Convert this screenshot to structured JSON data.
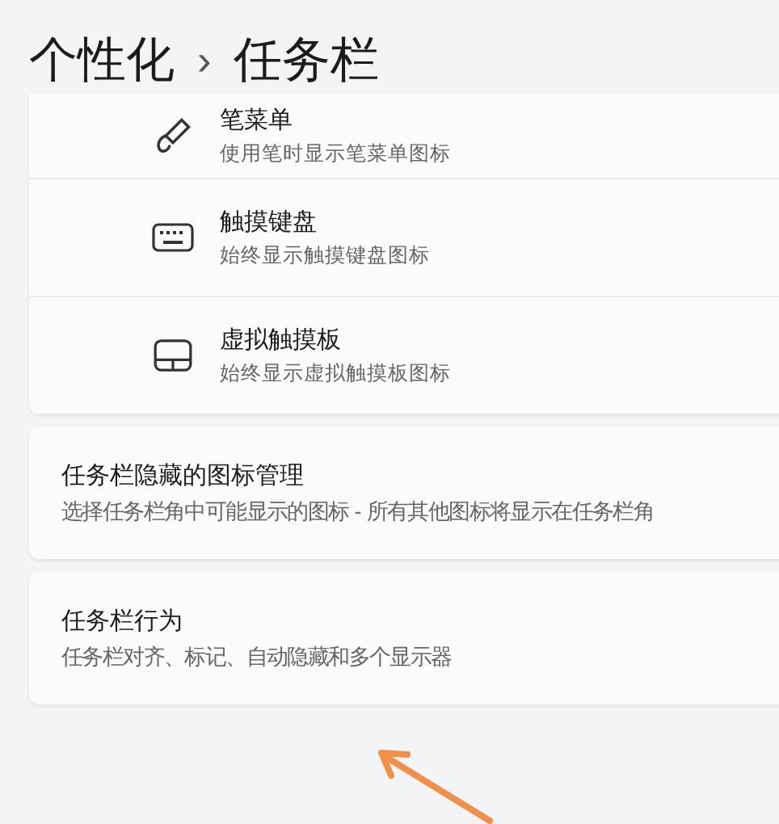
{
  "breadcrumb": {
    "parent": "个性化",
    "separator": "›",
    "current": "任务栏"
  },
  "corner_overflow_items": [
    {
      "kind": "pen",
      "title": "笔菜单",
      "subtitle": "使用笔时显示笔菜单图标"
    },
    {
      "kind": "keyboard",
      "title": "触摸键盘",
      "subtitle": "始终显示触摸键盘图标"
    },
    {
      "kind": "touchpad",
      "title": "虚拟触摸板",
      "subtitle": "始终显示虚拟触摸板图标"
    }
  ],
  "sections": [
    {
      "title": "任务栏隐藏的图标管理",
      "subtitle": "选择任务栏角中可能显示的图标 - 所有其他图标将显示在任务栏角"
    },
    {
      "title": "任务栏行为",
      "subtitle": "任务栏对齐、标记、自动隐藏和多个显示器"
    }
  ]
}
